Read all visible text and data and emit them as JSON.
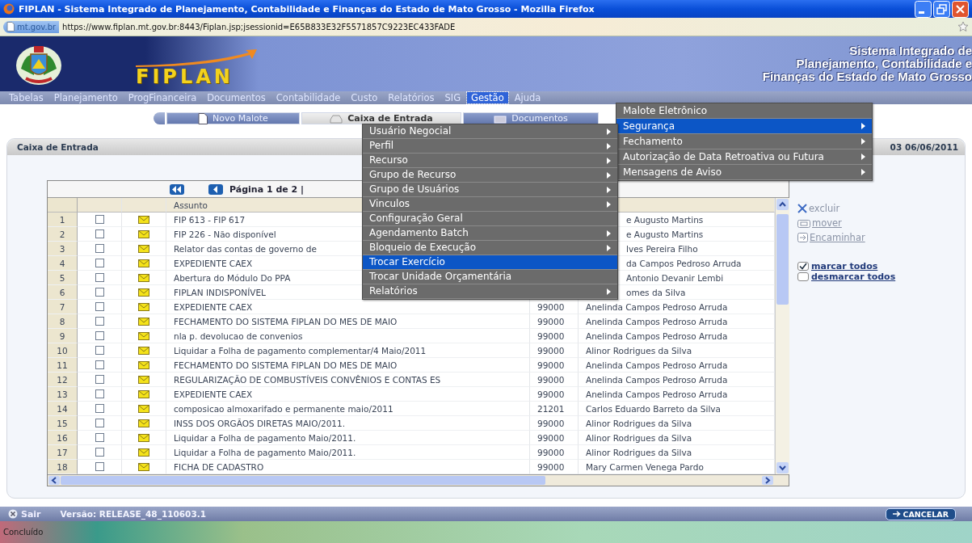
{
  "window": {
    "title": "FIPLAN - Sistema Integrado de Planejamento, Contabilidade e Finanças do Estado de Mato Grosso - Mozilla Firefox"
  },
  "address_bar": {
    "site": "mt.gov.br",
    "url": "https://www.fiplan.mt.gov.br:8443/Fiplan.jsp;jsessionid=E65B833E32F5571857C9223EC433FADE"
  },
  "banner": {
    "logo": "FIPLAN",
    "subtitle_lines": [
      "Sistema Integrado de",
      "Planejamento, Contabilidade e",
      "Finanças do Estado de Mato Grosso"
    ]
  },
  "menu_bar": [
    {
      "label": "Tabelas",
      "selected": false
    },
    {
      "label": "Planejamento",
      "selected": false
    },
    {
      "label": "ProgFinanceira",
      "selected": false
    },
    {
      "label": "Documentos",
      "selected": false
    },
    {
      "label": "Contabilidade",
      "selected": false
    },
    {
      "label": "Custo",
      "selected": false
    },
    {
      "label": "Relatórios",
      "selected": false
    },
    {
      "label": "SIG",
      "selected": false
    },
    {
      "label": "Gestão",
      "selected": true
    },
    {
      "label": "Ajuda",
      "selected": false
    }
  ],
  "tabs": [
    {
      "label": "Novo Malote",
      "selected": false
    },
    {
      "label": "Caixa de Entrada",
      "selected": true
    },
    {
      "label": "Documentos",
      "selected": false
    }
  ],
  "panel": {
    "title": "Caixa de Entrada",
    "info": "03 06/06/2011"
  },
  "table": {
    "pagination": "Página 1 de 2 |",
    "columns": [
      "Assunto"
    ],
    "rows": [
      {
        "number": "1",
        "checked": false,
        "subject": "FIP 613 - FIP 617",
        "name": "e Augusto Martins",
        "covered": true
      },
      {
        "number": "2",
        "checked": false,
        "subject": "FIP 226 - Não disponível",
        "name": "e Augusto Martins",
        "covered": true
      },
      {
        "number": "3",
        "checked": false,
        "subject": "Relator das contas de governo de",
        "name": "lves Pereira Filho",
        "covered": true
      },
      {
        "number": "4",
        "checked": false,
        "subject": "EXPEDIENTE CAEX",
        "name": "da Campos Pedroso Arruda",
        "covered": true
      },
      {
        "number": "5",
        "checked": false,
        "subject": "Abertura do Módulo Do PPA",
        "name": "Antonio Devanir Lembi",
        "covered": true
      },
      {
        "number": "6",
        "checked": false,
        "subject": "FIPLAN INDISPONÍVEL",
        "name": "omes da Silva",
        "covered": true
      },
      {
        "number": "7",
        "checked": false,
        "subject": "EXPEDIENTE CAEX",
        "code": "99000",
        "name": "Anelinda Campos Pedroso Arruda",
        "covered": false
      },
      {
        "number": "8",
        "checked": false,
        "subject": "FECHAMENTO DO SISTEMA FIPLAN DO MES DE MAIO",
        "code": "99000",
        "name": "Anelinda Campos Pedroso Arruda",
        "covered": false
      },
      {
        "number": "9",
        "checked": false,
        "subject": "nla p. devolucao de convenios",
        "code": "99000",
        "name": "Anelinda Campos Pedroso Arruda",
        "covered": false
      },
      {
        "number": "10",
        "checked": false,
        "subject": "Liquidar a Folha de pagamento complementar/4 Maio/2011",
        "code": "99000",
        "name": "Alinor Rodrigues da Silva",
        "covered": false
      },
      {
        "number": "11",
        "checked": false,
        "subject": "FECHAMENTO DO SISTEMA FIPLAN DO MES DE MAIO",
        "code": "99000",
        "name": "Anelinda Campos Pedroso Arruda",
        "covered": false
      },
      {
        "number": "12",
        "checked": false,
        "subject": "REGULARIZAÇÃO DE COMBUSTÍVEIS CONVÊNIOS E CONTAS ES",
        "code": "99000",
        "name": "Anelinda Campos Pedroso Arruda",
        "covered": false
      },
      {
        "number": "13",
        "checked": false,
        "subject": "EXPEDIENTE CAEX",
        "code": "99000",
        "name": "Anelinda Campos Pedroso Arruda",
        "covered": false
      },
      {
        "number": "14",
        "checked": false,
        "subject": "composicao almoxarifado e permanente maio/2011",
        "code": "21201",
        "name": "Carlos Eduardo Barreto da Silva",
        "covered": false
      },
      {
        "number": "15",
        "checked": false,
        "subject": "INSS DOS ORGÃOS DIRETAS MAIO/2011.",
        "code": "99000",
        "name": "Alinor Rodrigues da Silva",
        "covered": false
      },
      {
        "number": "16",
        "checked": false,
        "subject": "Liquidar a Folha de pagamento Maio/2011.",
        "code": "99000",
        "name": "Alinor Rodrigues da Silva",
        "covered": false
      },
      {
        "number": "17",
        "checked": false,
        "subject": "Liquidar a Folha de pagamento Maio/2011.",
        "code": "99000",
        "name": "Alinor Rodrigues da Silva",
        "covered": false
      },
      {
        "number": "18",
        "checked": false,
        "subject": "FICHA DE CADASTRO",
        "code": "99000",
        "name": "Mary Carmen Venega Pardo",
        "covered": false
      }
    ]
  },
  "actions": [
    {
      "label": "excluir",
      "kind": "delete"
    },
    {
      "label": "mover",
      "kind": "move"
    },
    {
      "label": "Encaminhar",
      "kind": "forward"
    }
  ],
  "select_links": [
    {
      "label": "marcar todos",
      "checked": true
    },
    {
      "label": "desmarcar todos",
      "checked": false
    }
  ],
  "gestao_menu": {
    "items": [
      {
        "label": "Malote Eletrônico",
        "selected": false,
        "submenu": false
      },
      {
        "label": "Segurança",
        "selected": true,
        "submenu": true
      },
      {
        "label": "Fechamento",
        "selected": false,
        "submenu": true
      },
      {
        "label": "Autorização de Data Retroativa ou Futura",
        "selected": false,
        "submenu": true
      },
      {
        "label": "Mensagens de Aviso",
        "selected": false,
        "submenu": true
      }
    ]
  },
  "seguranca_submenu": {
    "items": [
      {
        "label": "Usuário Negocial",
        "selected": false,
        "submenu": true
      },
      {
        "label": "Perfil",
        "selected": false,
        "submenu": true
      },
      {
        "label": "Recurso",
        "selected": false,
        "submenu": true
      },
      {
        "label": "Grupo de Recurso",
        "selected": false,
        "submenu": true
      },
      {
        "label": "Grupo de Usuários",
        "selected": false,
        "submenu": true
      },
      {
        "label": "Vinculos",
        "selected": false,
        "submenu": true
      },
      {
        "label": "Configuração Geral",
        "selected": false,
        "submenu": false
      },
      {
        "label": "Agendamento Batch",
        "selected": false,
        "submenu": true
      },
      {
        "label": "Bloqueio de Execução",
        "selected": false,
        "submenu": true
      },
      {
        "label": "Trocar Exercício",
        "selected": true,
        "submenu": false
      },
      {
        "label": "Trocar Unidade Orçamentária",
        "selected": false,
        "submenu": false
      },
      {
        "label": "Relatórios",
        "selected": false,
        "submenu": true
      }
    ]
  },
  "footer": {
    "exit": "Sair",
    "version": "Versão: RELEASE_48_110603.1",
    "cancel": "CANCELAR"
  },
  "status_bar": "Concluído"
}
